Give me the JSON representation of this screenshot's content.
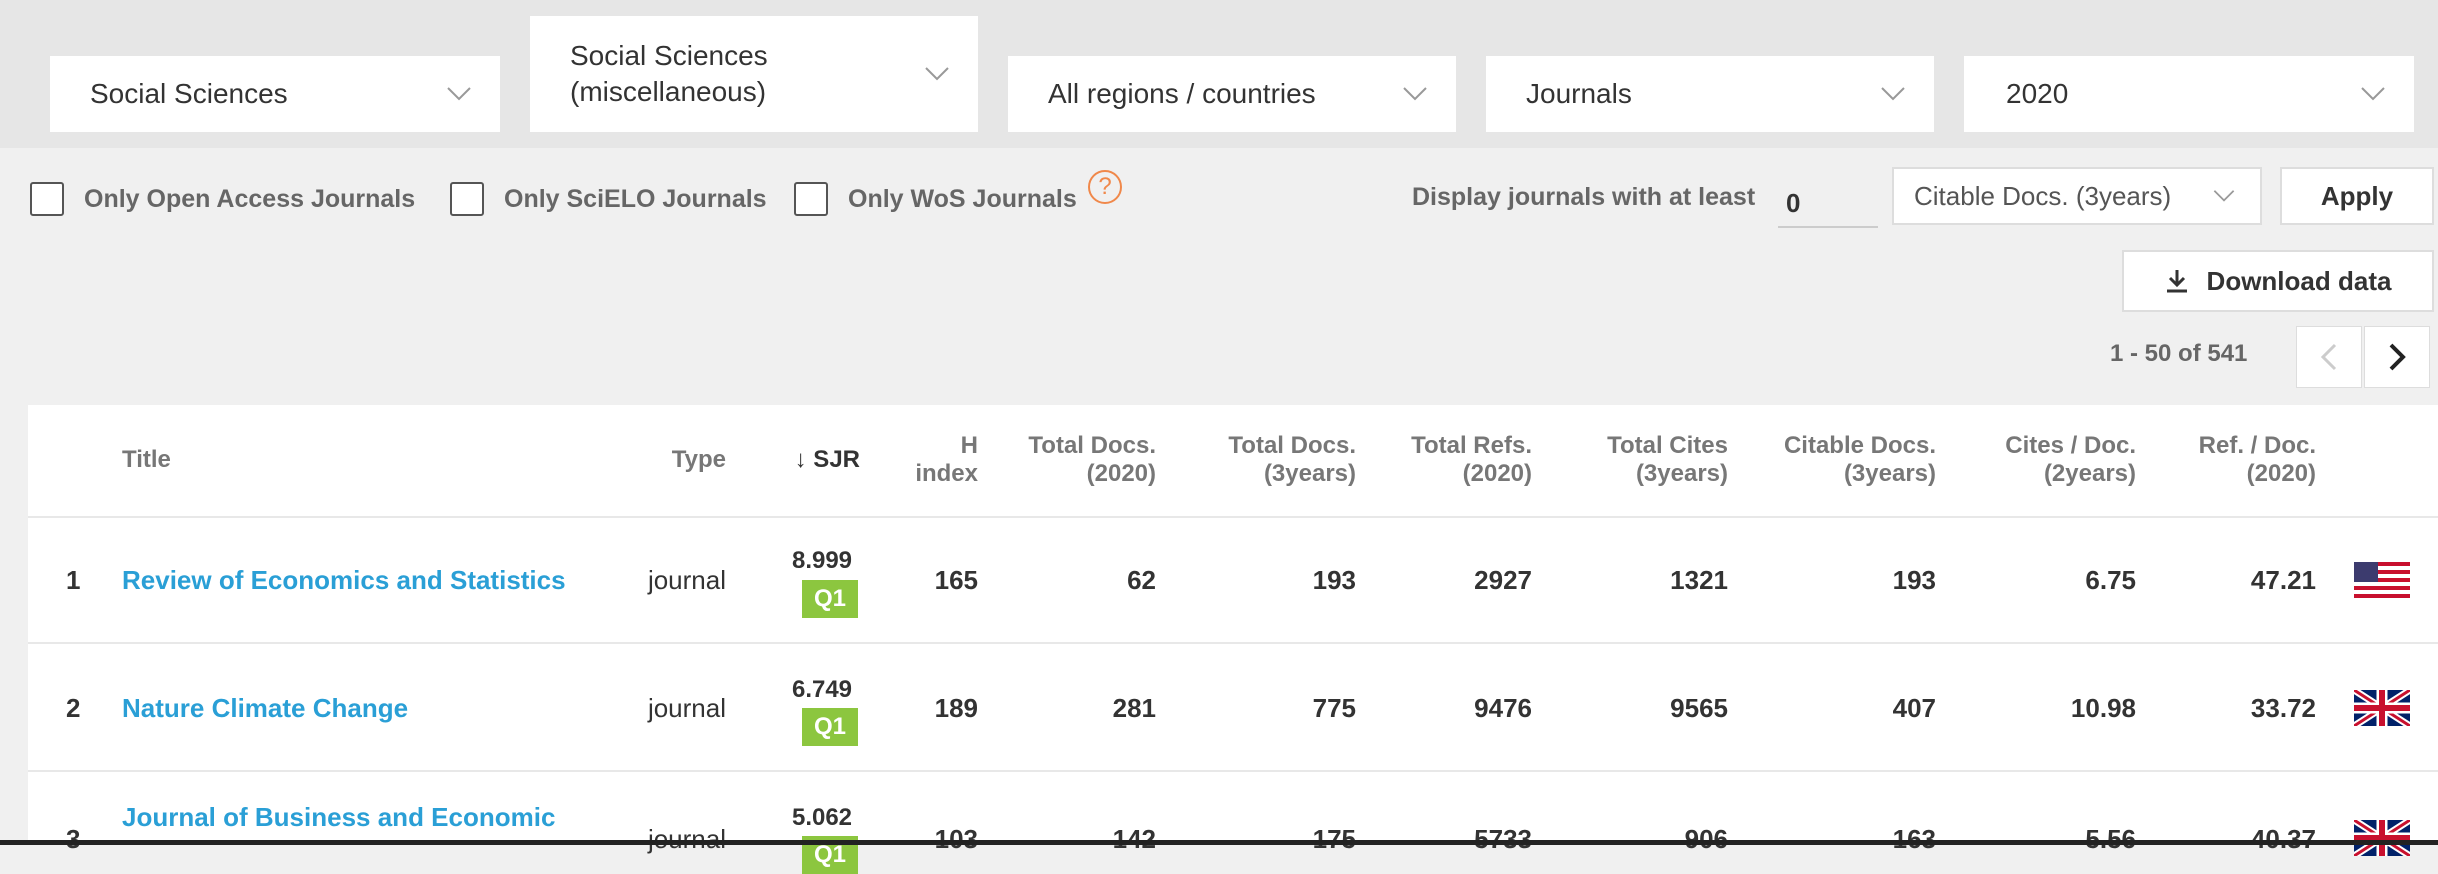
{
  "filters": {
    "subject_area": "Social Sciences",
    "subject_category_line1": "Social Sciences",
    "subject_category_line2": "(miscellaneous)",
    "region": "All regions / countries",
    "type": "Journals",
    "year": "2020"
  },
  "options": {
    "open_access": "Only Open Access Journals",
    "scielo": "Only SciELO Journals",
    "wos": "Only WoS Journals",
    "help_icon": "?",
    "display_label": "Display journals with at least",
    "min_value": "0",
    "min_metric": "Citable Docs. (3years)",
    "apply": "Apply"
  },
  "download": {
    "label": "Download data",
    "icon": "download-icon"
  },
  "pagination": {
    "label": "1 - 50 of 541"
  },
  "table": {
    "headers": {
      "title": "Title",
      "type": "Type",
      "sjr": "↓ SJR",
      "h_index_1": "H",
      "h_index_2": "index",
      "total_docs_1": "Total Docs.",
      "total_docs_2": "(2020)",
      "total_docs3_1": "Total Docs.",
      "total_docs3_2": "(3years)",
      "total_refs_1": "Total Refs.",
      "total_refs_2": "(2020)",
      "total_cites_1": "Total Cites",
      "total_cites_2": "(3years)",
      "citable_1": "Citable Docs.",
      "citable_2": "(3years)",
      "cites_doc_1": "Cites / Doc.",
      "cites_doc_2": "(2years)",
      "ref_doc_1": "Ref. / Doc.",
      "ref_doc_2": "(2020)"
    },
    "rows": [
      {
        "rank": "1",
        "title": "Review of Economics and Statistics",
        "type": "journal",
        "sjr": "8.999",
        "quartile": "Q1",
        "h_index": "165",
        "total_docs": "62",
        "total_docs_3y": "193",
        "total_refs": "2927",
        "total_cites": "1321",
        "citable_docs": "193",
        "cites_per_doc": "6.75",
        "refs_per_doc": "47.21",
        "country_flag": "us-flag-icon"
      },
      {
        "rank": "2",
        "title": "Nature Climate Change",
        "type": "journal",
        "sjr": "6.749",
        "quartile": "Q1",
        "h_index": "189",
        "total_docs": "281",
        "total_docs_3y": "775",
        "total_refs": "9476",
        "total_cites": "9565",
        "citable_docs": "407",
        "cites_per_doc": "10.98",
        "refs_per_doc": "33.72",
        "country_flag": "uk-flag-icon"
      },
      {
        "rank": "3",
        "title": "Journal of Business and Economic",
        "type": "journal",
        "sjr": "5.062",
        "quartile": "Q1",
        "h_index": "103",
        "total_docs": "142",
        "total_docs_3y": "175",
        "total_refs": "5733",
        "total_cites": "906",
        "citable_docs": "163",
        "cites_per_doc": "5.56",
        "refs_per_doc": "40.37",
        "country_flag": "uk-flag-icon"
      }
    ]
  },
  "colors": {
    "link": "#2a9fd6",
    "q1": "#8cc63f",
    "help": "#f0884a"
  }
}
